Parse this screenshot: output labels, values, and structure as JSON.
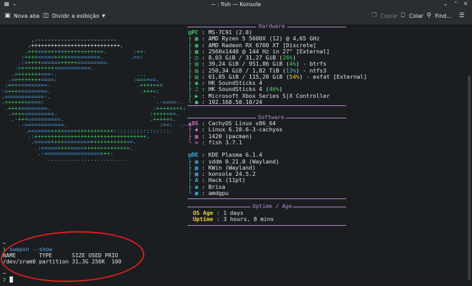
{
  "window": {
    "title": "~ : fish — Konsole"
  },
  "toolbar": {
    "new_tab": "Nova aba",
    "split_view": "Dividir a exibição",
    "copy": "Copiar",
    "paste": "Colar",
    "find": "Find..."
  },
  "hardware": {
    "title": "Hardware",
    "pc_label": "PC",
    "pc_value": "MS-7C91 (2.0)",
    "cpu": "AMD Ryzen 5 5600X (12) @ 4,65 GHz",
    "gpu": "AMD Radeon RX 6700 XT [Discrete]",
    "display": "2560x1440 @ 144 Hz in 27\" [External]",
    "memory_a": "8,03 GiB / 31,27 GiB (",
    "memory_pct": "26%",
    "memory_b": ")",
    "disk1_a": "39,24 GiB / 951,86 GiB (",
    "disk1_pct": "4%",
    "disk1_b": ") - btrfs",
    "disk2_a": "250,34 GiB / 1,82 TiB (",
    "disk2_pct": "13%",
    "disk2_b": ") - ntfs3",
    "disk3_a": "61,85 GiB / 115,20 GiB (",
    "disk3_pct": "54%",
    "disk3_b": ") - exfat [External]",
    "audio1": "HK SoundSticks 4",
    "audio2_a": "HK SoundSticks 4 (",
    "audio2_pct": "46%",
    "audio2_b": ")",
    "gamepad": "Microsoft Xbox Series S|X Controller",
    "ip": "192.168.50.10/24"
  },
  "software": {
    "title": "Software",
    "os_label": "OS",
    "os_value": "CachyOS Linux x86_64",
    "kernel": "Linux 6.10.6-3-cachyos",
    "packages": "1420 (pacman)",
    "shell": "fish 3.7.1",
    "de_label": "DE",
    "de_value": "KDE Plasma 6.1.4",
    "dm": "sddm 0.21.0 (Wayland)",
    "wm": "KWin (Wayland)",
    "terminal": "konsole 24.5.2",
    "font": "Hack (11pt)",
    "theme": "Brisa",
    "driver": "amdgpu"
  },
  "uptime": {
    "title": "Uptime / Age",
    "os_age_label": "OS Age",
    "os_age_value": ": 1 days",
    "uptime_label": "Uptime",
    "uptime_value": ": 3 hours, 8 mins"
  },
  "terminal": {
    "cwd1": "~",
    "command": "swapon --show",
    "header": "NAME       TYPE      SIZE USED PRIO",
    "row": "/dev/zram0 partition 31,3G 256K  100",
    "cwd2": "~"
  }
}
